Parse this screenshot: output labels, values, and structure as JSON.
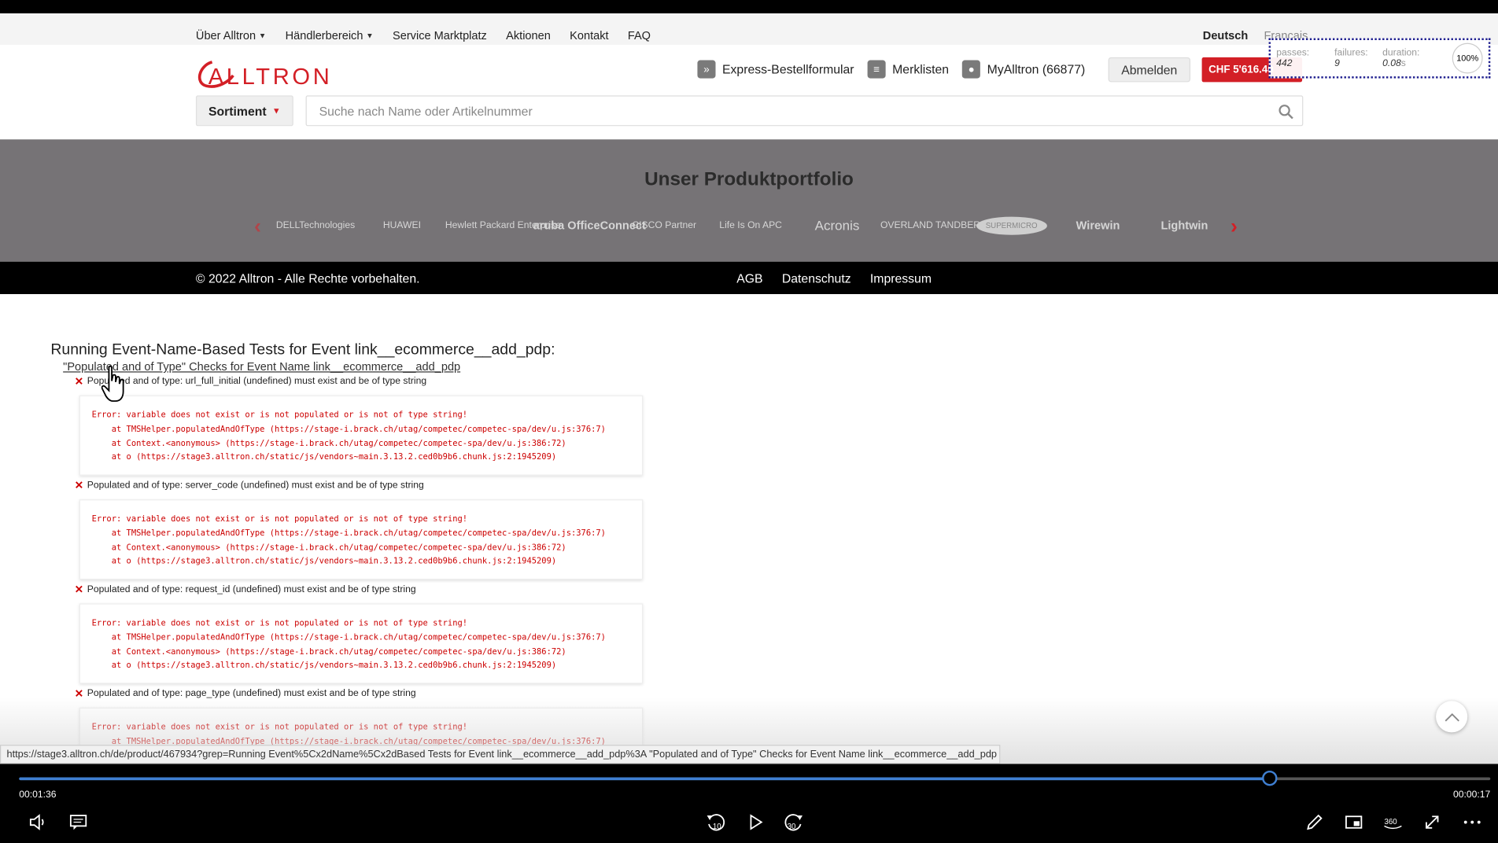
{
  "topnav": {
    "items": [
      {
        "label": "Über Alltron",
        "dropdown": true
      },
      {
        "label": "Händlerbereich",
        "dropdown": true
      },
      {
        "label": "Service Marktplatz",
        "dropdown": false
      },
      {
        "label": "Aktionen",
        "dropdown": false
      },
      {
        "label": "Kontakt",
        "dropdown": false
      },
      {
        "label": "FAQ",
        "dropdown": false
      }
    ],
    "lang_active": "Deutsch",
    "lang_other": "Français"
  },
  "header": {
    "logo_text": "ALLTRON",
    "express": "Express-Bestellformular",
    "merklisten": "Merklisten",
    "myalltron": "MyAlltron (66877)",
    "logout": "Abmelden",
    "balance": "CHF 5'616.40",
    "sortiment": "Sortiment",
    "search_placeholder": "Suche nach Name oder Artikelnummer",
    "brand_color": "#d31f26"
  },
  "stats": {
    "passes_label": "passes:",
    "passes": "442",
    "failures_label": "failures:",
    "failures": "9",
    "duration_label": "duration:",
    "duration": "0.08",
    "duration_unit": "s",
    "progress": "100%"
  },
  "portfolio": {
    "title": "Unser Produktportfolio",
    "brands": [
      "DELLTechnologies",
      "HUAWEI",
      "Hewlett Packard Enterprise",
      "aruba OfficeConnect",
      "CISCO Partner",
      "Life Is On APC",
      "Acronis",
      "OVERLAND TANDBERG",
      "SUPERMICRO",
      "Wirewin",
      "Lightwin"
    ]
  },
  "footer": {
    "copyright": "© 2022 Alltron - Alle Rechte vorbehalten.",
    "links": [
      "AGB",
      "Datenschutz",
      "Impressum"
    ]
  },
  "report": {
    "suite_title": "Running Event-Name-Based Tests for Event link__ecommerce__add_pdp:",
    "suite_sub": "\"Populated and of Type\" Checks for Event Name link__ecommerce__add_pdp",
    "tests": [
      {
        "title": "Populated and of type: url_full_initial (undefined) must exist and be of type string",
        "error": "Error: variable does not exist or is not populated or is not of type string!\n    at TMSHelper.populatedAndOfType (https://stage-i.brack.ch/utag/competec/competec-spa/dev/u.js:376:7)\n    at Context.<anonymous> (https://stage-i.brack.ch/utag/competec/competec-spa/dev/u.js:386:72)\n    at o (https://stage3.alltron.ch/static/js/vendors~main.3.13.2.ced0b9b6.chunk.js:2:1945209)"
      },
      {
        "title": "Populated and of type: server_code (undefined) must exist and be of type string",
        "error": "Error: variable does not exist or is not populated or is not of type string!\n    at TMSHelper.populatedAndOfType (https://stage-i.brack.ch/utag/competec/competec-spa/dev/u.js:376:7)\n    at Context.<anonymous> (https://stage-i.brack.ch/utag/competec/competec-spa/dev/u.js:386:72)\n    at o (https://stage3.alltron.ch/static/js/vendors~main.3.13.2.ced0b9b6.chunk.js:2:1945209)"
      },
      {
        "title": "Populated and of type: request_id (undefined) must exist and be of type string",
        "error": "Error: variable does not exist or is not populated or is not of type string!\n    at TMSHelper.populatedAndOfType (https://stage-i.brack.ch/utag/competec/competec-spa/dev/u.js:376:7)\n    at Context.<anonymous> (https://stage-i.brack.ch/utag/competec/competec-spa/dev/u.js:386:72)\n    at o (https://stage3.alltron.ch/static/js/vendors~main.3.13.2.ced0b9b6.chunk.js:2:1945209)"
      },
      {
        "title": "Populated and of type: page_type (undefined) must exist and be of type string",
        "error": "Error: variable does not exist or is not populated or is not of type string!\n    at TMSHelper.populatedAndOfType (https://stage-i.brack.ch/utag/competec/competec-spa/dev/u.js:376:7)"
      }
    ]
  },
  "player": {
    "status_url": "https://stage3.alltron.ch/de/product/467934?grep=Running Event%5Cx2dName%5Cx2dBased Tests for Event link__ecommerce__add_pdp%3A \"Populated and of Type\" Checks for Event Name link__ecommerce__add_pdp",
    "current_time": "00:01:36",
    "remaining_time": "00:00:17",
    "progress": 0.85,
    "accent": "#3f7fd1"
  }
}
